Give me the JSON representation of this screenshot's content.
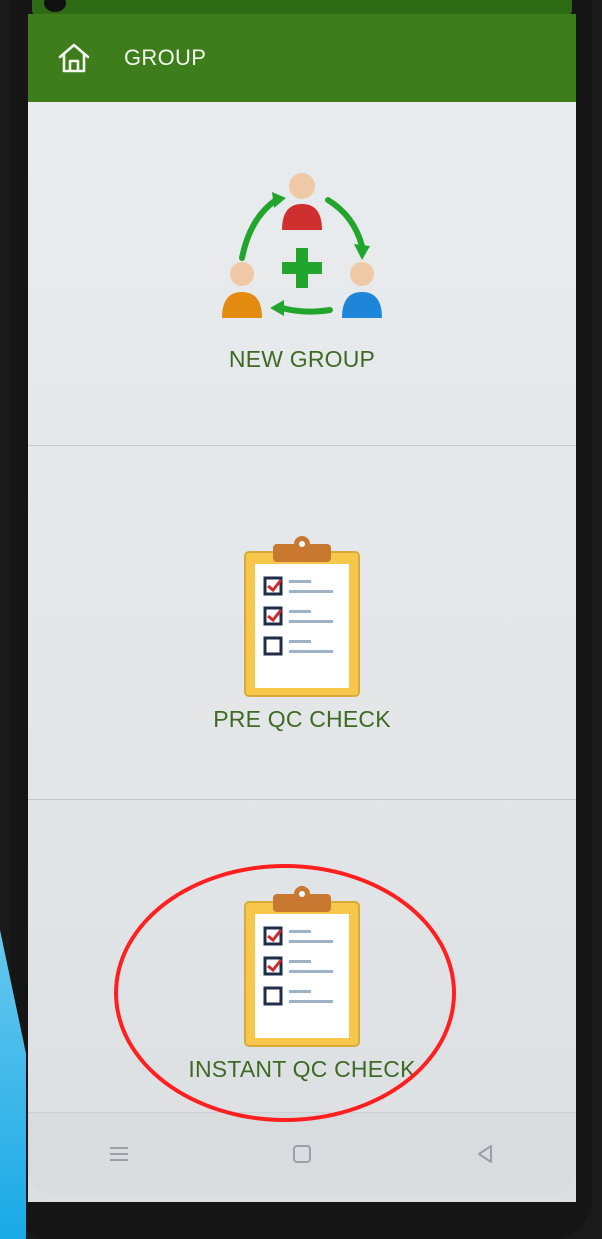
{
  "appbar": {
    "title": "GROUP",
    "home_icon": "home-icon",
    "color": "#3d7d1c"
  },
  "tiles": [
    {
      "label": "NEW GROUP",
      "icon": "group-add-icon"
    },
    {
      "label": "PRE QC CHECK",
      "icon": "clipboard-checklist-icon"
    },
    {
      "label": "INSTANT QC CHECK",
      "icon": "clipboard-checklist-icon"
    }
  ],
  "navbar": {
    "menu_icon": "menu-icon",
    "home_icon": "square-home-icon",
    "back_icon": "back-triangle-icon"
  },
  "colors": {
    "label_text": "#3f6a24",
    "highlight": "#ff1f1f",
    "accent_green": "#22a52c"
  }
}
